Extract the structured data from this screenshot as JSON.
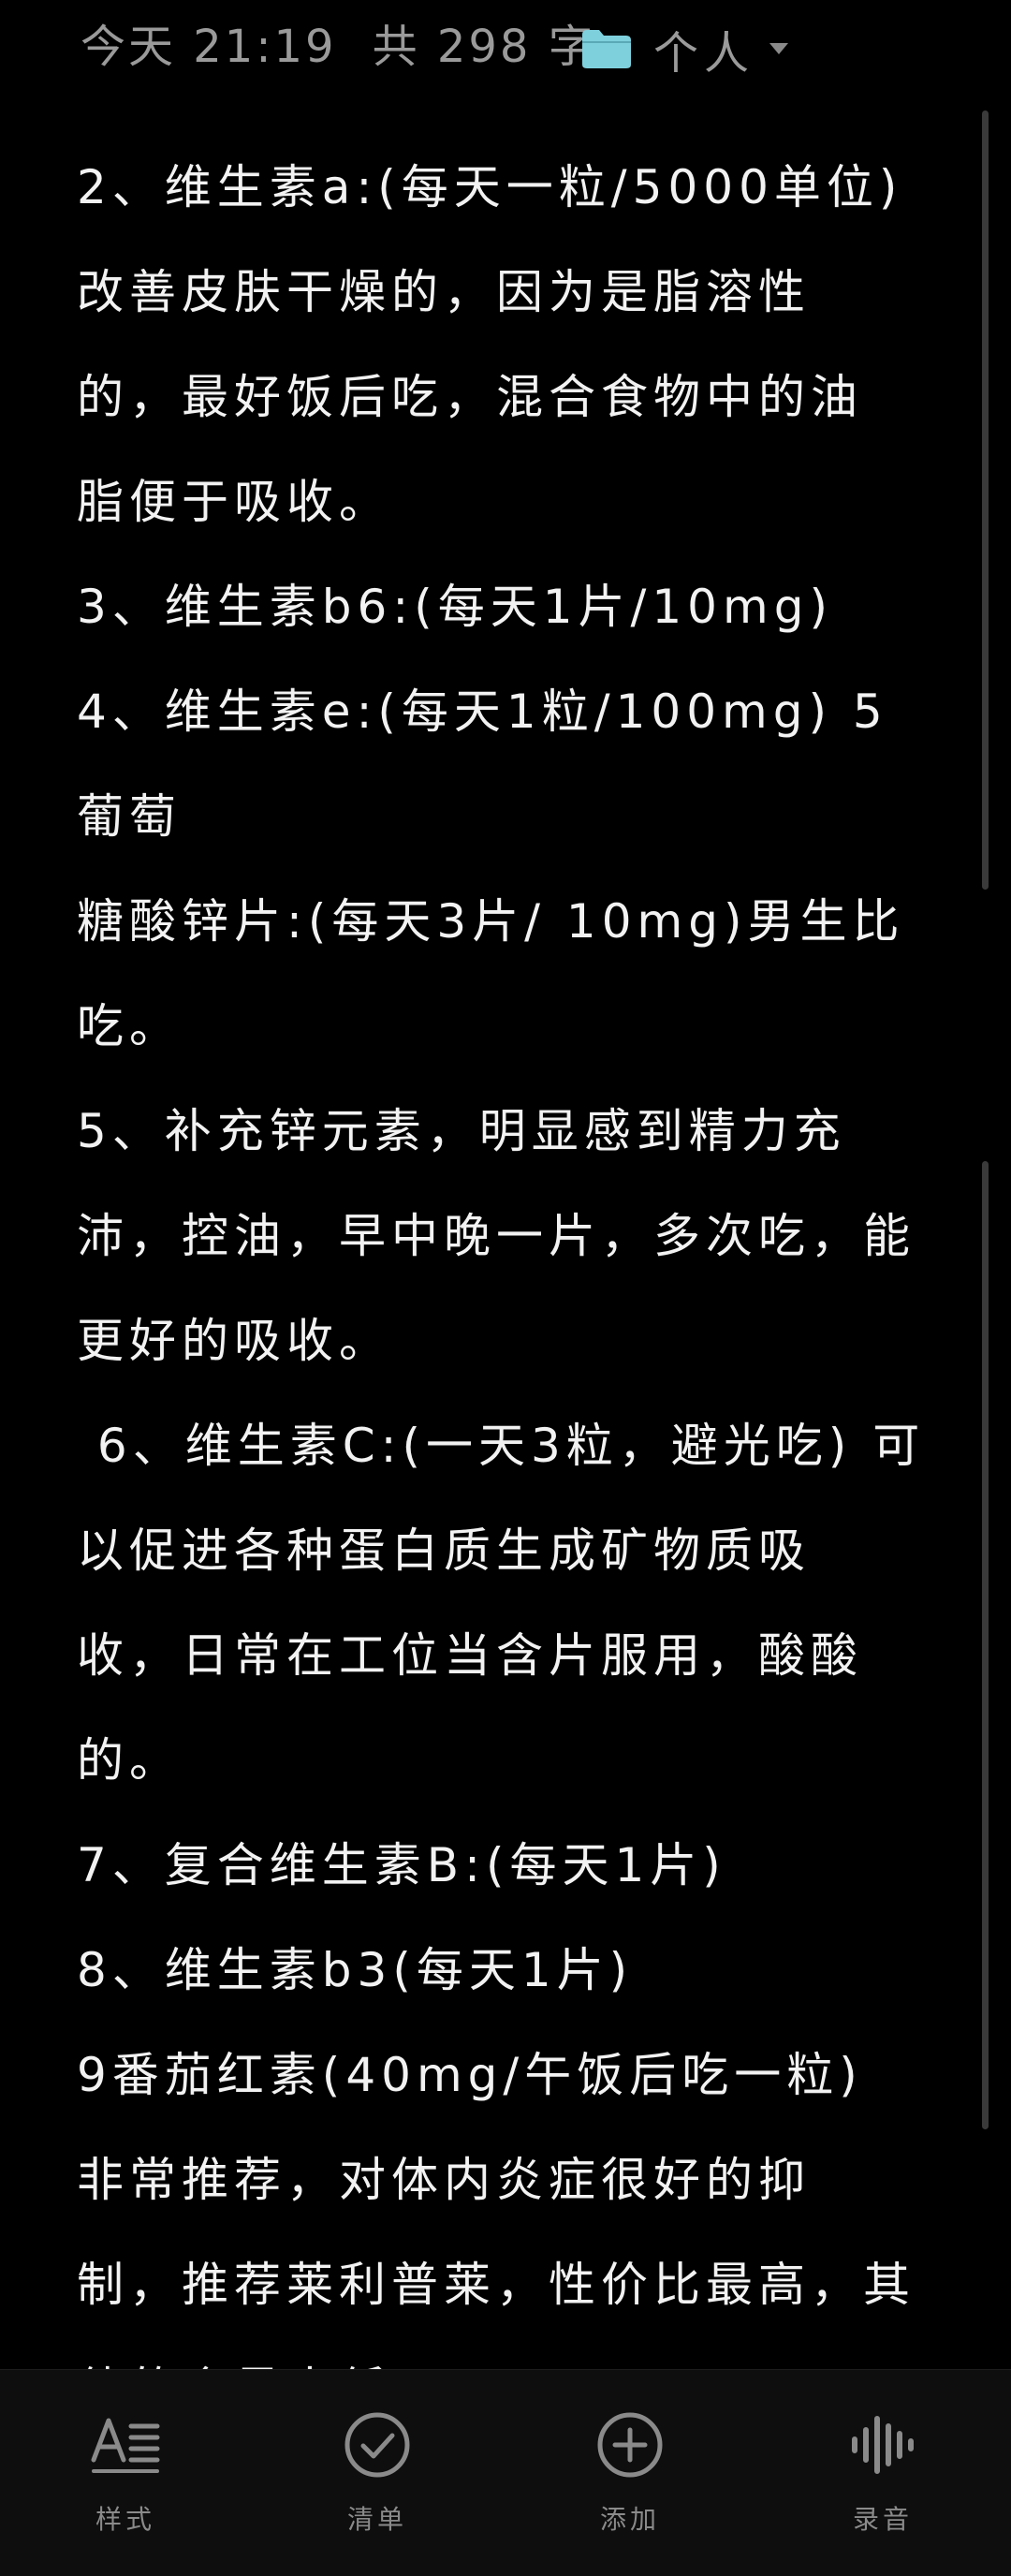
{
  "header": {
    "date": "今天 21:19",
    "word_count": "共 298 字",
    "folder_label": "个人",
    "folder_icon": "folder-icon",
    "folder_color": "#7fd0dd"
  },
  "note": {
    "lines": [
      "2、维生素a:(每天一粒/5000单位)",
      "改善皮肤干燥的，因为是脂溶性",
      "的，最好饭后吃，混合食物中的油",
      "脂便于吸收。",
      "3、维生素b6:(每天1片/10mg)",
      "4、维生素e:(每天1粒/100mg) 5葡萄",
      "糖酸锌片:(每天3片/ 10mg)男生比",
      "吃。",
      "5、补充锌元素，明显感到精力充",
      "沛，控油，早中晚一片，多次吃，能",
      "更好的吸收。",
      " 6、维生素C:(一天3粒，避光吃) 可",
      "以促进各种蛋白质生成矿物质吸",
      "收，日常在工位当含片服用，酸酸",
      "的。",
      "7、复合维生素B:(每天1片)",
      "8、维生素b3(每天1片)",
      "9番茄红素(40mg/午饭后吃一粒)",
      "非常推荐，对体内炎症很好的抑",
      "制，推荐莱利普莱，性价比最高，其",
      "他的含量太低。"
    ]
  },
  "toolbar": {
    "style_label": "样式",
    "list_label": "清单",
    "add_label": "添加",
    "record_label": "录音"
  }
}
